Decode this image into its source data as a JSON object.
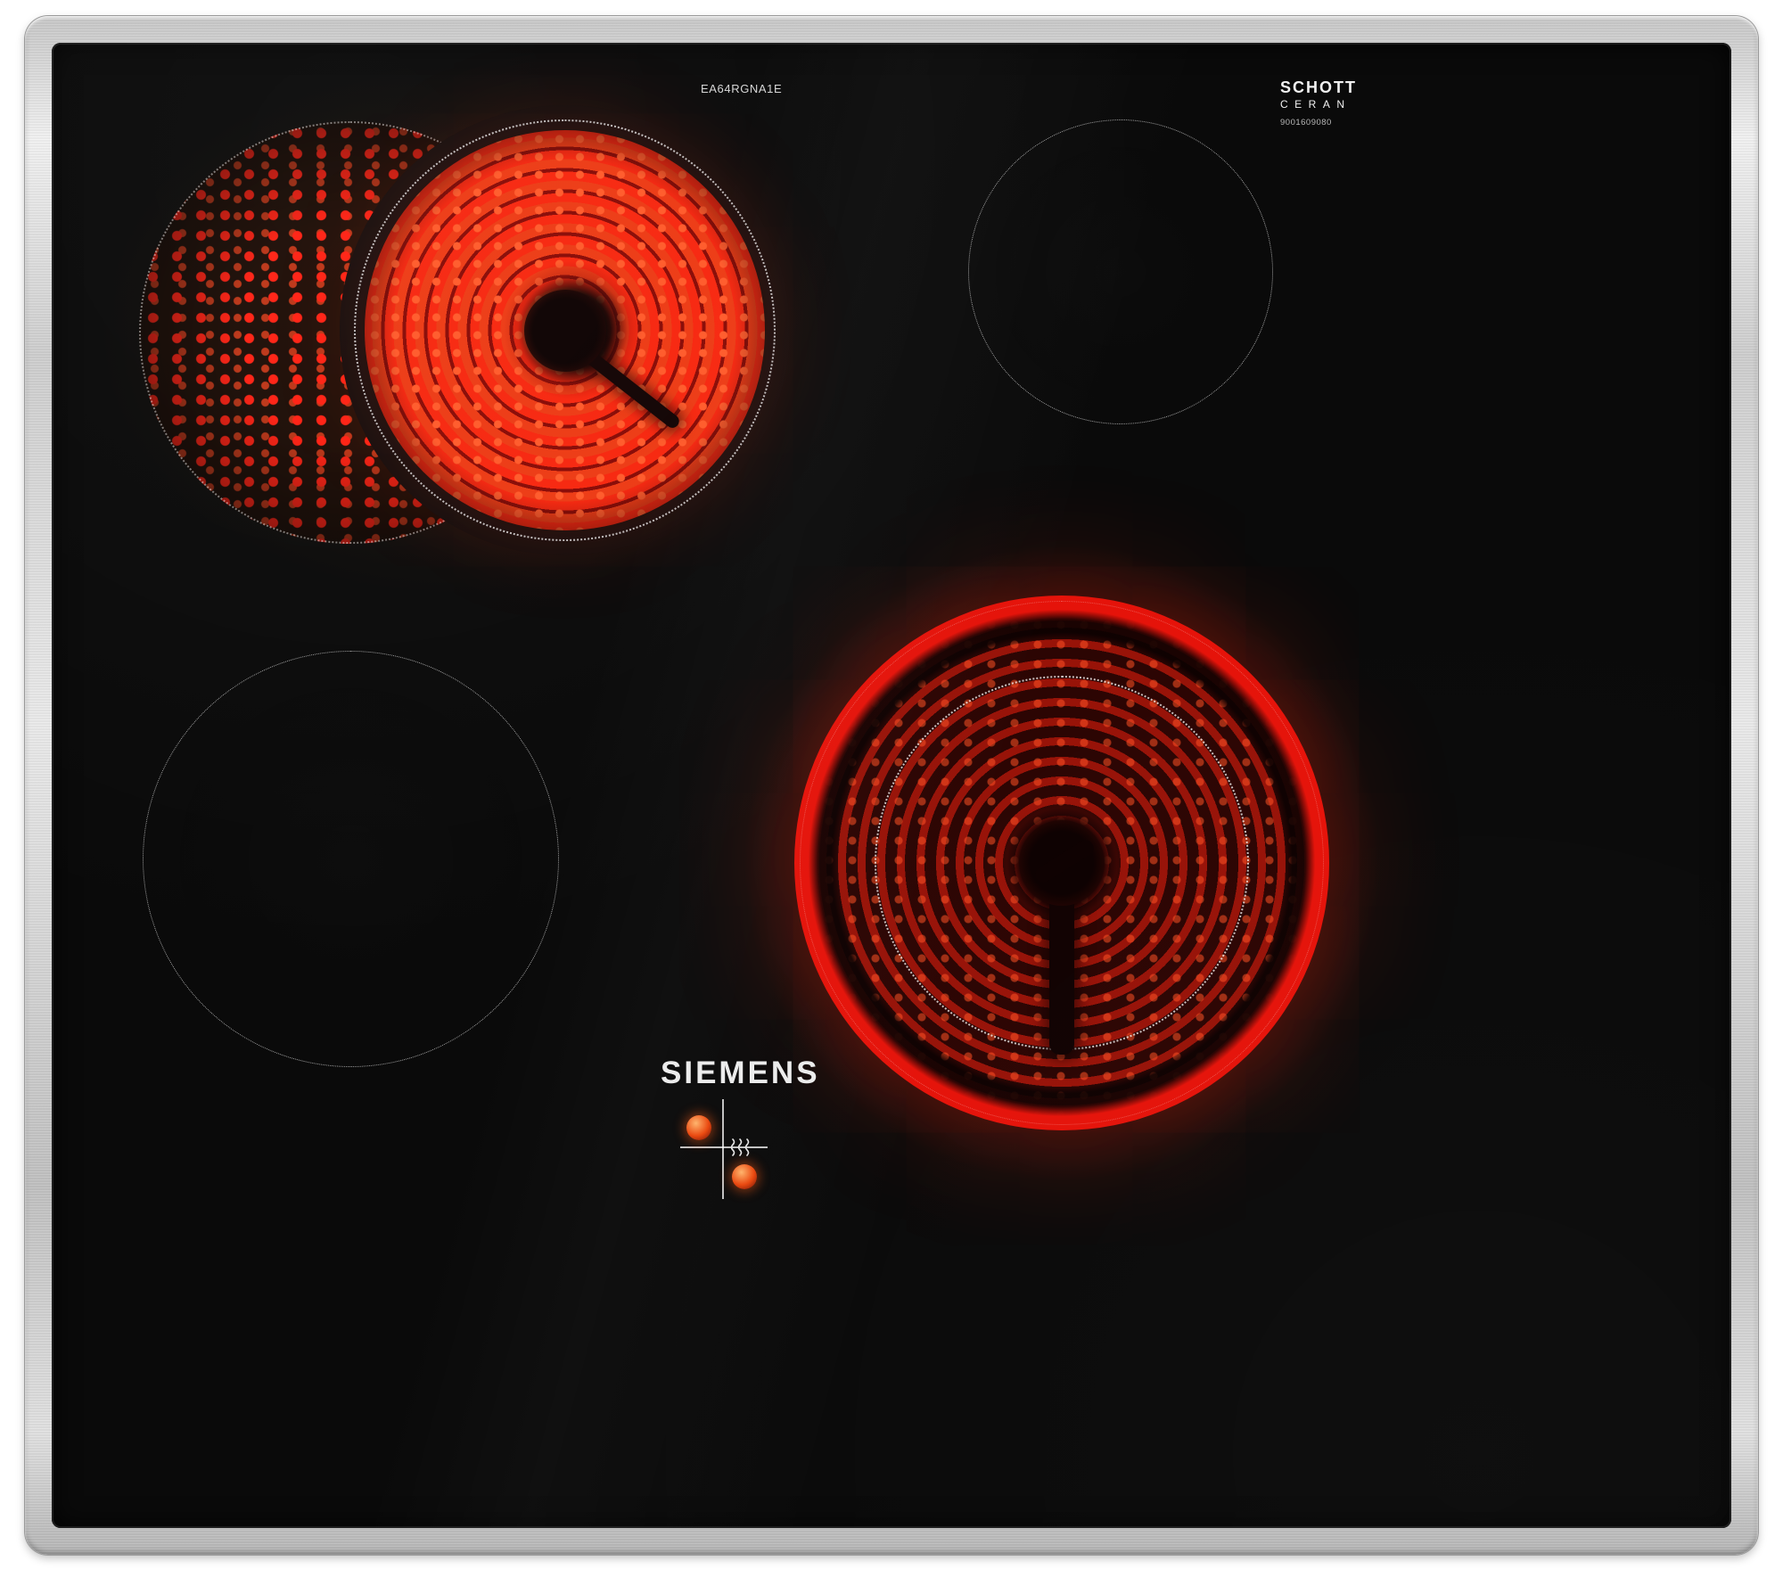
{
  "product": {
    "model": "EA64RGNA1E",
    "brand": "SIEMENS",
    "glass_brand_line1": "SCHOTT",
    "glass_brand_line2": "CERAN",
    "glass_serial": "9001609080"
  },
  "colors": {
    "glass_black": "#0a0a0a",
    "frame_steel": "#d9d9d9",
    "element_glow_red": "#e5130a",
    "indicator_dot_red": "#ea470d",
    "print_white": "#ececec"
  },
  "zones": {
    "rear_left": "dual radiant element, on",
    "rear_right": "radiant element, off",
    "front_left": "radiant element, off",
    "front_right": "large radiant element, on"
  },
  "icons": {
    "heat_indicator": "heat-waves-icon"
  }
}
